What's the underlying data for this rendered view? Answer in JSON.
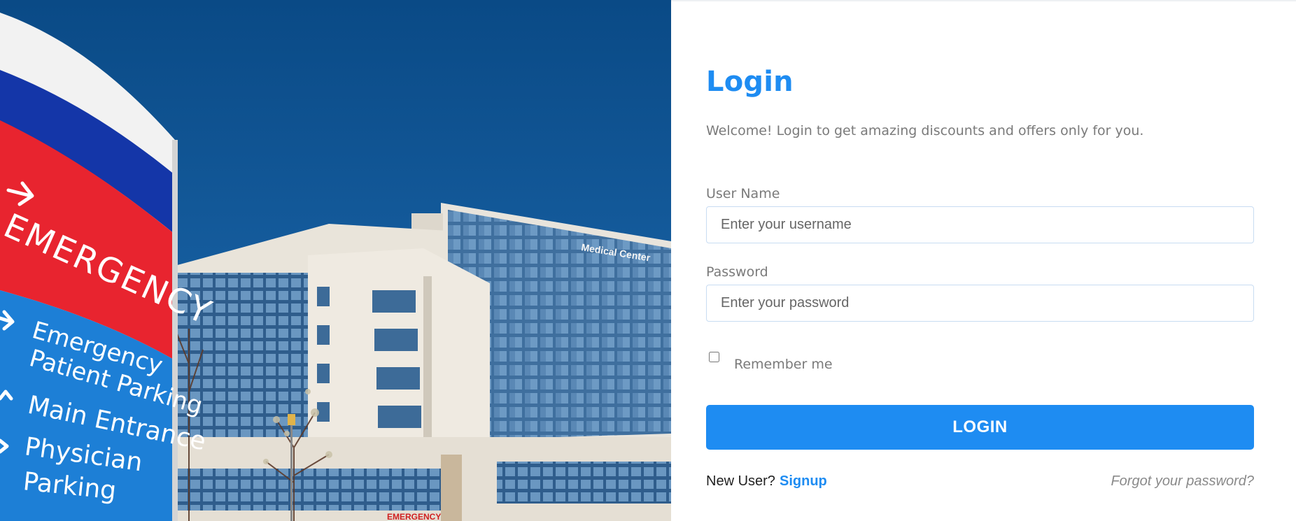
{
  "login": {
    "title": "Login",
    "subtitle": "Welcome! Login to get amazing discounts and offers only for you.",
    "username": {
      "label": "User Name",
      "placeholder": "Enter your username"
    },
    "password": {
      "label": "Password",
      "placeholder": "Enter your password"
    },
    "remember_label": "Remember me",
    "login_button": "LOGIN",
    "new_user_text": "New User?",
    "signup_link": "Signup",
    "forgot_link": "Forgot your password?"
  },
  "photo": {
    "sign_text": [
      "EMERGENCY",
      "Emergency",
      "Patient Parking",
      "Main Entrance",
      "Physician",
      "Parking"
    ],
    "building_sign": "Medical Center",
    "small_sign": "EMERGENCY"
  },
  "colors": {
    "accent": "#1e8cf2"
  }
}
